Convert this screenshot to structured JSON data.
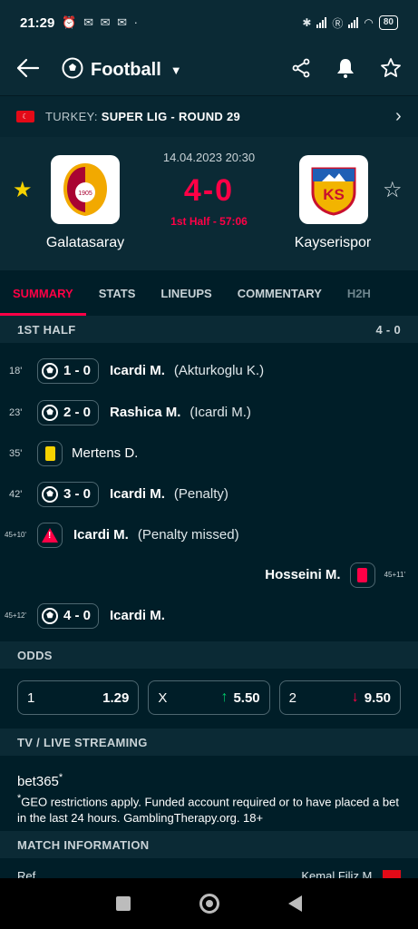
{
  "status": {
    "time": "21:29",
    "battery": "80"
  },
  "app": {
    "sport": "Football"
  },
  "league": {
    "country": "TURKEY:",
    "competition": "SUPER LIG - ROUND 29"
  },
  "match": {
    "datetime": "14.04.2023 20:30",
    "score": "4-0",
    "status": "1st Half - 57:06",
    "home": {
      "name": "Galatasaray",
      "logo_text": "1905"
    },
    "away": {
      "name": "Kayserispor",
      "logo_text": "KS"
    }
  },
  "tabs": [
    "SUMMARY",
    "STATS",
    "LINEUPS",
    "COMMENTARY",
    "H2H"
  ],
  "half": {
    "label": "1ST HALF",
    "score": "4 - 0"
  },
  "events": [
    {
      "minute": "18'",
      "score": "1 - 0",
      "player": "Icardi M.",
      "detail": "(Akturkoglu K.)"
    },
    {
      "minute": "23'",
      "score": "2 - 0",
      "player": "Rashica M.",
      "detail": "(Icardi M.)"
    },
    {
      "minute": "35'",
      "player": "Mertens D."
    },
    {
      "minute": "42'",
      "score": "3 - 0",
      "player": "Icardi M.",
      "detail": "(Penalty)"
    },
    {
      "minute": "45+10'",
      "player": "Icardi M.",
      "detail": "(Penalty missed)"
    },
    {
      "minute": "45+11'",
      "player": "Hosseini M."
    },
    {
      "minute": "45+12'",
      "score": "4 - 0",
      "player": "Icardi M."
    }
  ],
  "odds_section": {
    "title": "ODDS",
    "items": [
      {
        "label": "1",
        "value": "1.29",
        "trend": ""
      },
      {
        "label": "X",
        "value": "5.50",
        "trend": "up"
      },
      {
        "label": "2",
        "value": "9.50",
        "trend": "down"
      }
    ]
  },
  "tv": {
    "title": "TV / LIVE STREAMING",
    "brand": "bet365",
    "brand_mark": "*",
    "note_mark": "*",
    "note": "GEO restrictions apply. Funded account required or to have placed a bet in the last 24 hours. GamblingTherapy.org. 18+"
  },
  "match_info": {
    "title": "MATCH INFORMATION",
    "left": "Ref",
    "right": "Kemal Filiz M."
  },
  "colors": {
    "accent": "#ff0046",
    "background": "#001e28",
    "panel": "#0b2a35",
    "yellow_card": "#f6d200",
    "odds_up": "#00c96b"
  }
}
